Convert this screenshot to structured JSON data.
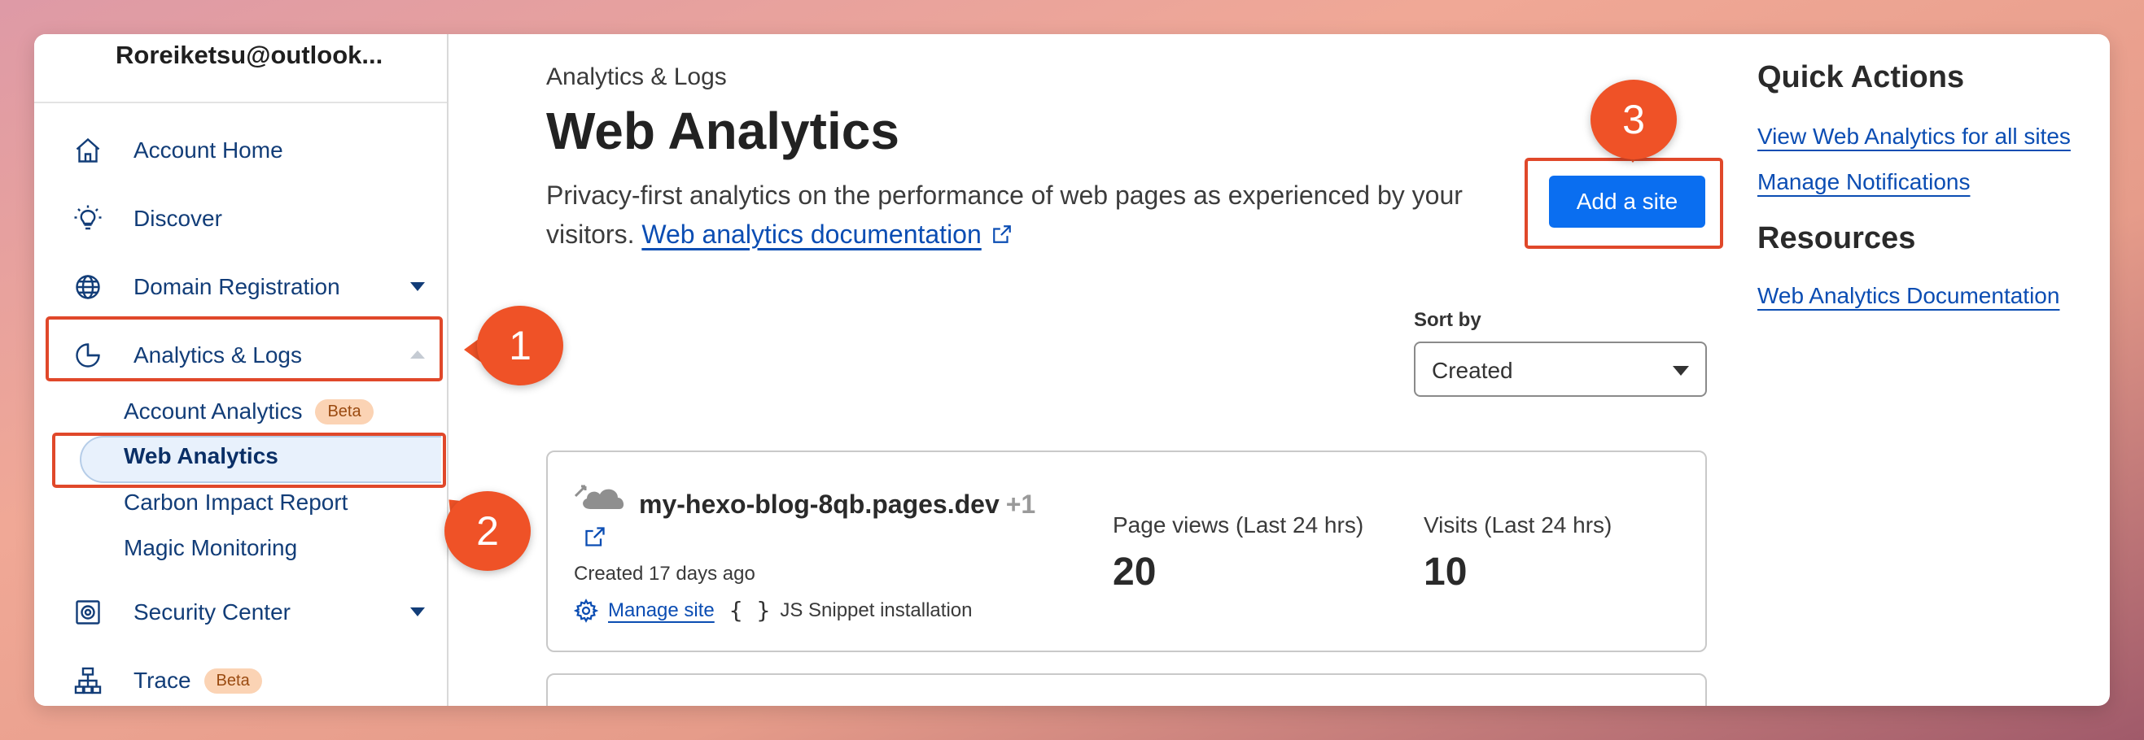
{
  "sidebar": {
    "account_name": "Roreiketsu@outlook...",
    "items": [
      {
        "label": "Account Home",
        "icon": "home-icon"
      },
      {
        "label": "Discover",
        "icon": "lightbulb-icon"
      },
      {
        "label": "Domain Registration",
        "icon": "globe-icon"
      },
      {
        "label": "Analytics & Logs",
        "icon": "pie-chart-icon"
      },
      {
        "label": "Security Center",
        "icon": "shield-target-icon"
      },
      {
        "label": "Trace",
        "icon": "network-tree-icon"
      }
    ],
    "sub_items": [
      {
        "label": "Account Analytics",
        "badge": "Beta"
      },
      {
        "label": "Web Analytics"
      },
      {
        "label": "Carbon Impact Report"
      },
      {
        "label": "Magic Monitoring"
      }
    ],
    "trace_badge": "Beta"
  },
  "main": {
    "breadcrumb": "Analytics & Logs",
    "title": "Web Analytics",
    "description": "Privacy-first analytics on the performance of web pages as experienced by your visitors.",
    "doc_link": "Web analytics documentation",
    "add_site_label": "Add a site",
    "sort_label": "Sort by",
    "sort_value": "Created",
    "site": {
      "name": "my-hexo-blog-8qb.pages.dev",
      "extra": "+1",
      "created": "Created 17 days ago",
      "manage_label": "Manage site",
      "braces": "{ }",
      "snippet_label": "JS Snippet installation",
      "page_views_label": "Page views (Last 24 hrs)",
      "page_views_value": "20",
      "visits_label": "Visits (Last 24 hrs)",
      "visits_value": "10"
    }
  },
  "right": {
    "quick_title": "Quick Actions",
    "quick_links": [
      "View Web Analytics for all sites",
      "Manage Notifications"
    ],
    "resources_title": "Resources",
    "resource_links": [
      "Web Analytics Documentation"
    ]
  },
  "callouts": [
    "1",
    "2",
    "3"
  ],
  "colors": {
    "accent": "#0a6ef0",
    "callout": "#ef5227",
    "link": "#0b4db3",
    "nav_text": "#123d78"
  }
}
